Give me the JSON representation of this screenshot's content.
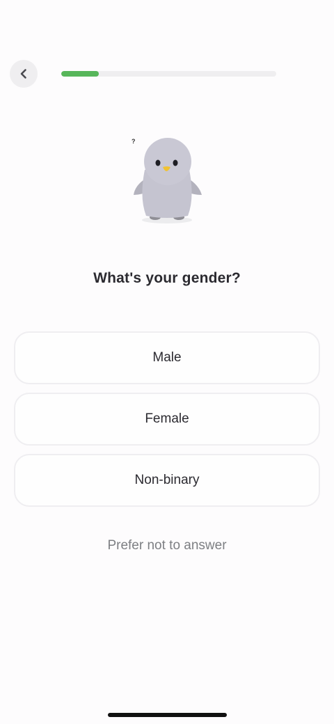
{
  "header": {
    "back_icon": "chevron-left-icon",
    "progress": 0.175
  },
  "mascot": {
    "icon": "penguin-icon",
    "thought_mark": "?"
  },
  "question": {
    "title": "What's your gender?"
  },
  "options": [
    {
      "label": "Male"
    },
    {
      "label": "Female"
    },
    {
      "label": "Non-binary"
    }
  ],
  "skip": {
    "label": "Prefer not to answer"
  },
  "colors": {
    "accent": "#57b65a",
    "text": "#2b2a30",
    "muted": "#7d7f83",
    "border": "#efeef1"
  }
}
